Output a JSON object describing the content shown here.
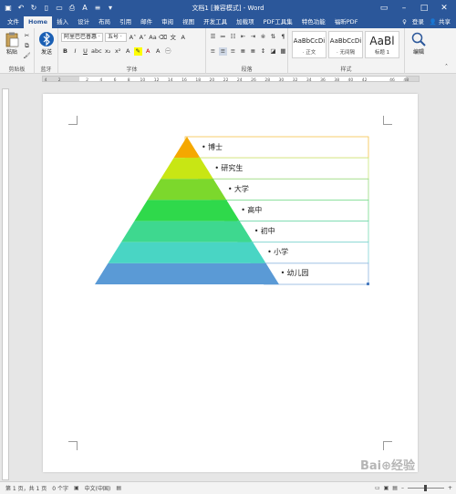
{
  "window": {
    "title": "文档1 [兼容模式] - Word",
    "controls": [
      "restore-icon",
      "minimize-icon",
      "maximize-icon",
      "close-icon"
    ]
  },
  "ribbon_tabs": [
    "文件",
    "Home",
    "插入",
    "设计",
    "布局",
    "引用",
    "邮件",
    "审阅",
    "视图",
    "开发工具",
    "加载项",
    "PDF工具集",
    "特色功能",
    "福昕PDF"
  ],
  "active_tab": "Home",
  "tell_me": "♀",
  "account": {
    "login": "登录",
    "share": "共享"
  },
  "ribbon": {
    "clipboard": {
      "label": "剪贴板",
      "paste": "粘贴"
    },
    "bluetooth": {
      "label": "蓝牙",
      "send": "发送"
    },
    "font": {
      "label": "字体",
      "font_name": "阿里巴巴普惠 ·",
      "font_size": "五号 ·"
    },
    "paragraph": {
      "label": "段落"
    },
    "styles": {
      "label": "样式",
      "items": [
        {
          "preview": "AaBbCcDi",
          "name": "· 正文"
        },
        {
          "preview": "AaBbCcDi",
          "name": "· 无间隔"
        },
        {
          "preview": "AaBl",
          "name": "标题 1"
        }
      ]
    },
    "editing": {
      "label": "编辑"
    }
  },
  "ruler": {
    "ticks": [
      "4",
      "2",
      "",
      "2",
      "4",
      "6",
      "8",
      "10",
      "12",
      "14",
      "16",
      "18",
      "20",
      "22",
      "24",
      "26",
      "28",
      "30",
      "32",
      "34",
      "36",
      "38",
      "40",
      "42",
      "",
      "46",
      "48"
    ]
  },
  "smartart": {
    "levels": [
      {
        "label": "博士",
        "color": "#f5a800"
      },
      {
        "label": "研究生",
        "color": "#c8e614"
      },
      {
        "label": "大学",
        "color": "#7cd82c"
      },
      {
        "label": "高中",
        "color": "#2fd94b"
      },
      {
        "label": "初中",
        "color": "#3ed88f"
      },
      {
        "label": "小学",
        "color": "#49d5c4"
      },
      {
        "label": "幼儿园",
        "color": "#5a9ad6"
      }
    ],
    "bullet": "•",
    "box_colors": [
      "#f5c24a",
      "#c8e67a",
      "#97d97d",
      "#74d98a",
      "#75d9b1",
      "#7fd2d4",
      "#8cb4e0"
    ]
  },
  "status": {
    "page": "第 1 页，共 1 页",
    "words": "0 个字",
    "lang": "中文(中国)",
    "zoom_level": 0.5
  },
  "watermark": "Bai⊕经验",
  "colors": {
    "accent": "#2b579a",
    "ribbon_bg": "#f3f3f3",
    "canvas": "#e6e6e6"
  }
}
